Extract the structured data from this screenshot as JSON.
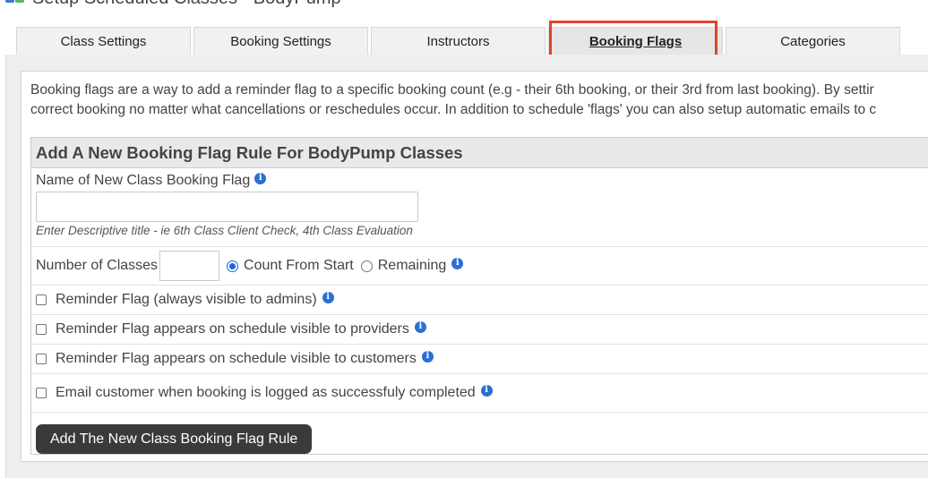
{
  "header": {
    "title": "Setup Scheduled Classes - BodyPump"
  },
  "tabs": [
    {
      "label": "Class Settings",
      "active": false
    },
    {
      "label": "Booking Settings",
      "active": false
    },
    {
      "label": "Instructors",
      "active": false
    },
    {
      "label": "Booking Flags",
      "active": true
    },
    {
      "label": "Categories",
      "active": false
    }
  ],
  "intro": {
    "line1": "Booking flags are a way to add a reminder flag to a specific booking count (e.g - their 6th booking, or their 3rd from last booking). By settir",
    "line2": "correct booking no matter what cancellations or reschedules occur. In addition to schedule 'flags' you can also setup automatic emails to c"
  },
  "form": {
    "title": "Add A New Booking Flag Rule For BodyPump Classes",
    "name_label": "Name of New Class Booking Flag",
    "name_value": "",
    "name_hint": "Enter Descriptive title - ie 6th Class Client Check, 4th Class Evaluation",
    "number_label": "Number of Classes",
    "number_value": "",
    "radio_count_from_start": "Count From Start",
    "radio_remaining": "Remaining",
    "selected_radio": "Count From Start",
    "checkbox_admin": "Reminder Flag (always visible to admins)",
    "checkbox_providers": "Reminder Flag appears on schedule visible to providers",
    "checkbox_customers": "Reminder Flag appears on schedule visible to customers",
    "checkbox_email": "Email customer when booking is logged as successfuly completed",
    "submit_label": "Add The New Class Booking Flag Rule"
  },
  "colors": {
    "highlight": "#e0442b",
    "info_icon": "#2a6fd6",
    "button_bg": "#3a3a3a"
  }
}
